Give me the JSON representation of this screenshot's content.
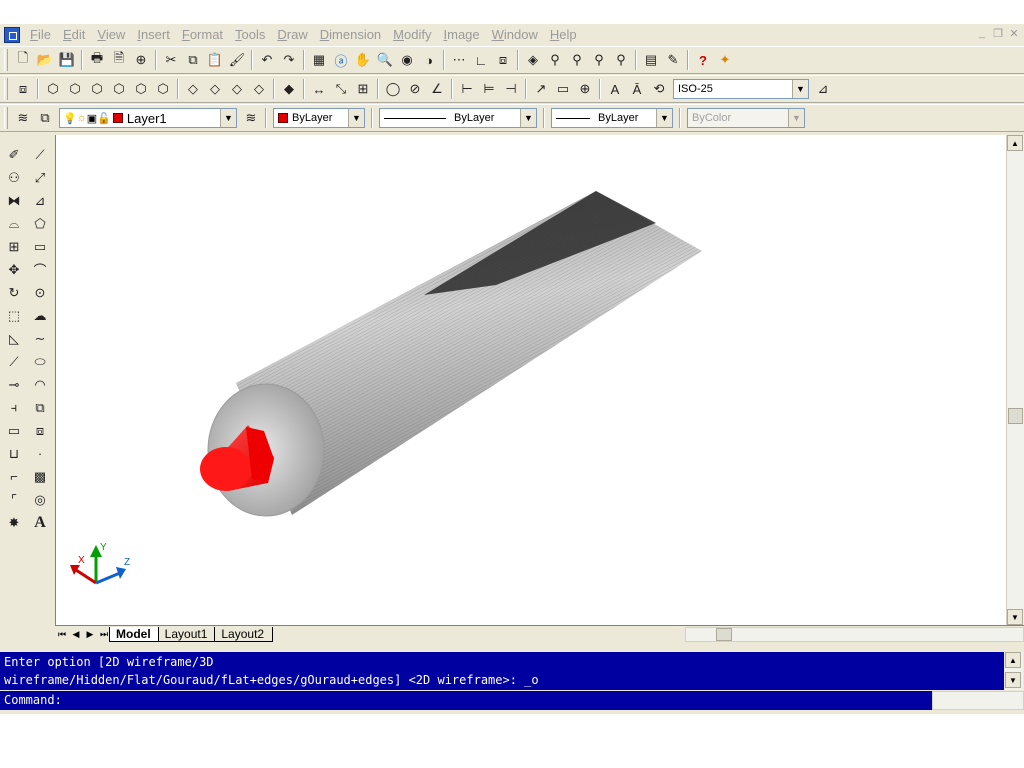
{
  "menubar": {
    "items": [
      "File",
      "Edit",
      "View",
      "Insert",
      "Format",
      "Tools",
      "Draw",
      "Dimension",
      "Modify",
      "Image",
      "Window",
      "Help"
    ]
  },
  "properties": {
    "layer": "Layer1",
    "color": "ByLayer",
    "linetype": "ByLayer",
    "lineweight": "ByLayer",
    "plotstyle": "ByColor"
  },
  "dimstyle": {
    "value": "ISO-25"
  },
  "tabs": [
    "Model",
    "Layout1",
    "Layout2"
  ],
  "ucs": {
    "x_label": "X",
    "y_label": "Y",
    "z_label": "Z"
  },
  "command": {
    "history_line1": "Enter option [2D wireframe/3D",
    "history_line2": "wireframe/Hidden/Flat/Gouraud/fLat+edges/gOuraud+edges] <2D wireframe>: _o",
    "prompt": "Command:"
  },
  "colors": {
    "model_body": "#b4b4b4",
    "model_tip": "#ff2020",
    "command_bg": "#0000a0"
  }
}
